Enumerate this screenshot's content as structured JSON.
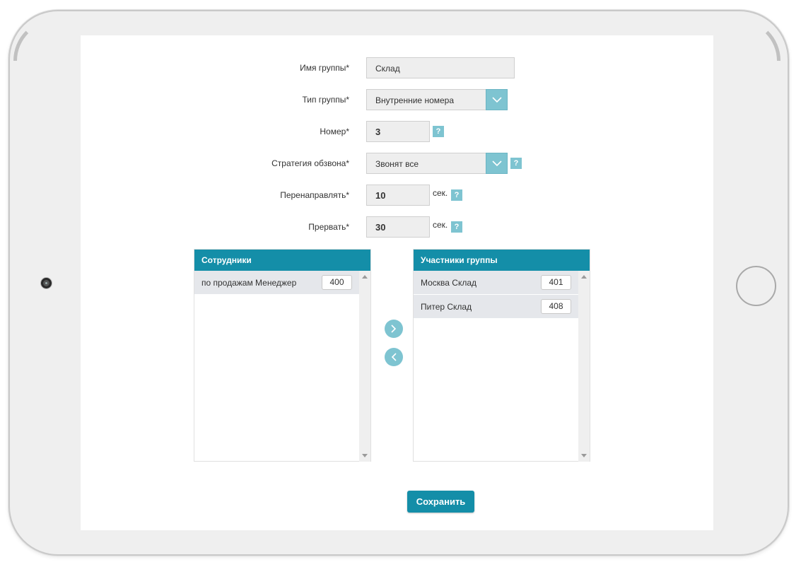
{
  "form": {
    "group_name": {
      "label": "Имя группы*",
      "value": "Склад"
    },
    "group_type": {
      "label": "Тип группы*",
      "value": "Внутренние номера"
    },
    "number": {
      "label": "Номер*",
      "value": "3",
      "help": "?"
    },
    "strategy": {
      "label": "Стратегия обзвона*",
      "value": "Звонят все",
      "help": "?"
    },
    "redirect": {
      "label": "Перенаправлять*",
      "value": "10",
      "unit": "сек.",
      "help": "?"
    },
    "abort": {
      "label": "Прервать*",
      "value": "30",
      "unit": "сек.",
      "help": "?"
    }
  },
  "employees": {
    "title": "Сотрудники",
    "items": [
      {
        "name": "по продажам Менеджер",
        "ext": "400"
      }
    ]
  },
  "members": {
    "title": "Участники группы",
    "items": [
      {
        "name": "Москва Склад",
        "ext": "401"
      },
      {
        "name": "Питер Склад",
        "ext": "408"
      }
    ]
  },
  "actions": {
    "save_label": "Сохранить"
  },
  "icons": {
    "dropdown": "chevron-down-icon",
    "move_right": "chevron-right-icon",
    "move_left": "chevron-left-icon"
  },
  "colors": {
    "accent": "#148ea8",
    "accent_light": "#7ec4d1"
  }
}
